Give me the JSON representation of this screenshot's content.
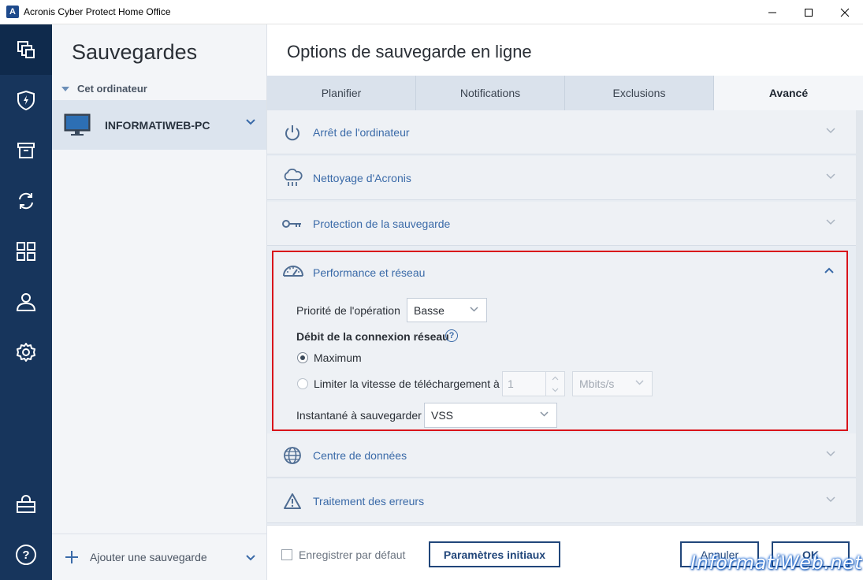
{
  "window": {
    "title": "Acronis Cyber Protect Home Office",
    "logo_letter": "A"
  },
  "rail": {
    "items": [
      "backup-icon",
      "protection-shield-icon",
      "archive-icon",
      "sync-icon",
      "tools-grid-icon",
      "account-icon",
      "settings-gear-icon",
      "store-bag-icon",
      "help-icon"
    ]
  },
  "backups": {
    "title": "Sauvegardes",
    "group_label": "Cet ordinateur",
    "selected_item": "INFORMATIWEB-PC",
    "add_label": "Ajouter une sauvegarde"
  },
  "main": {
    "title": "Options de sauvegarde en ligne",
    "tabs": [
      {
        "label": "Planifier"
      },
      {
        "label": "Notifications"
      },
      {
        "label": "Exclusions"
      },
      {
        "label": "Avancé",
        "active": true
      }
    ],
    "sections": [
      {
        "label": "Arrêt de l'ordinateur",
        "icon": "power-icon"
      },
      {
        "label": "Nettoyage d'Acronis",
        "icon": "cloud-rain-icon"
      },
      {
        "label": "Protection de la sauvegarde",
        "icon": "key-icon"
      },
      {
        "label": "Performance et réseau",
        "icon": "gauge-icon",
        "expanded": true
      },
      {
        "label": "Centre de données",
        "icon": "globe-icon"
      },
      {
        "label": "Traitement des erreurs",
        "icon": "warning-icon"
      }
    ],
    "performance": {
      "priority_label": "Priorité de l'opération",
      "priority_value": "Basse",
      "rate_label": "Débit de la connexion réseau",
      "help_glyph": "?",
      "option_max": "Maximum",
      "option_limit": "Limiter la vitesse de téléchargement à",
      "limit_value": "1",
      "limit_unit": "Mbits/s",
      "snapshot_label": "Instantané à sauvegarder",
      "snapshot_value": "VSS"
    }
  },
  "footer": {
    "default_label": "Enregistrer par défaut",
    "reset_label": "Paramètres initiaux",
    "cancel_label": "Annuler",
    "ok_label": "OK"
  },
  "watermark": "InformatiWeb.net",
  "colors": {
    "rail_bg": "#17355c",
    "accent_blue": "#3a6aa8",
    "highlight_red": "#d9141b",
    "button_border": "#21467a"
  }
}
